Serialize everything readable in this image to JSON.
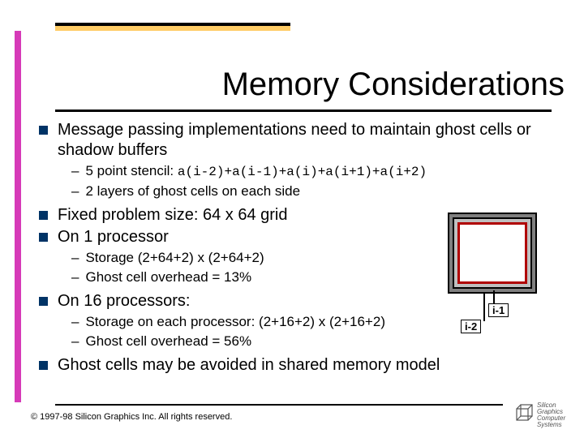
{
  "title": "Memory Considerations",
  "bullets": {
    "b1": "Message passing implementations need to maintain ghost cells or shadow buffers",
    "b1_subs": {
      "s1_prefix": "5 point stencil: ",
      "s1_code": "a(i-2)+a(i-1)+a(i)+a(i+1)+a(i+2)",
      "s2": "2 layers of ghost cells on each side"
    },
    "b2": "Fixed problem size: 64 x 64 grid",
    "b3": "On 1 processor",
    "b3_subs": {
      "s1": "Storage (2+64+2) x (2+64+2)",
      "s2": "Ghost cell overhead = 13%"
    },
    "b4": "On 16 processors:",
    "b4_subs": {
      "s1": "Storage on each processor: (2+16+2) x (2+16+2)",
      "s2": "Ghost cell overhead = 56%"
    },
    "b5": "Ghost cells may be avoided in shared memory model"
  },
  "diagram": {
    "label_inner": "i-1",
    "label_outer": "i-2"
  },
  "footer": {
    "copyright": "© 1997-98 Silicon Graphics Inc. All rights reserved.",
    "logo_line1": "Silicon Graphics",
    "logo_line2": "Computer Systems"
  }
}
